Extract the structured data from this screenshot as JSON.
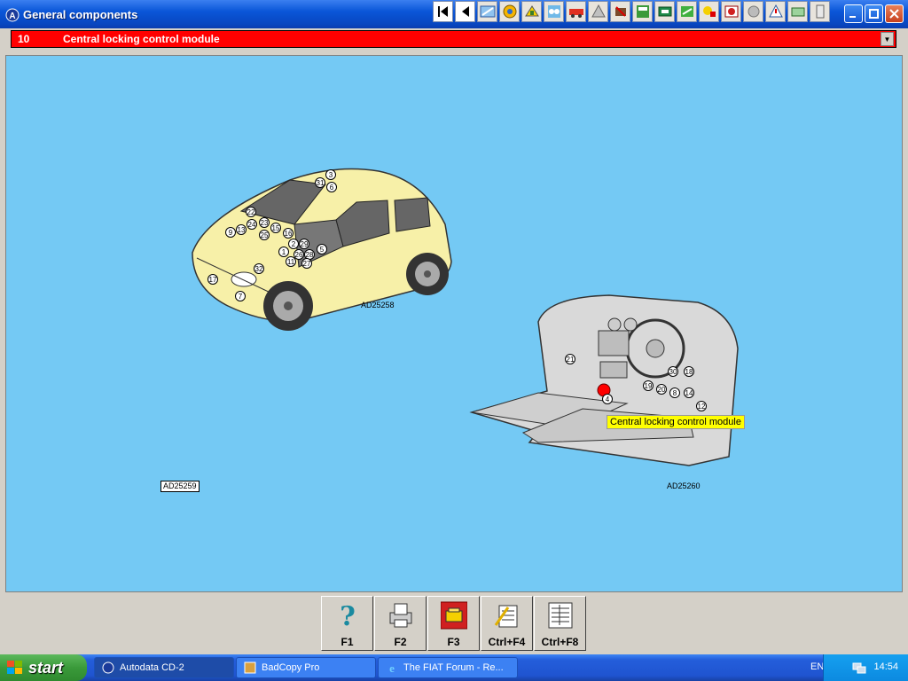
{
  "window": {
    "title": "General components",
    "toolbar_icons": [
      "first-page-icon",
      "previous-page-icon",
      "tool-1-icon",
      "tool-2-icon",
      "tool-3-icon",
      "tool-4-icon",
      "tool-5-icon",
      "tool-6-icon",
      "tool-7-icon",
      "tool-8-icon",
      "tool-9-icon",
      "tool-10-icon",
      "tool-11-icon",
      "tool-12-icon",
      "tool-13-icon",
      "tool-14-icon",
      "tool-15-icon"
    ]
  },
  "selector": {
    "number": "10",
    "value": "Central locking control module"
  },
  "diagram": {
    "car_ref": "AD25258",
    "dash_ref": "AD25260",
    "box_ref": "AD25259",
    "tooltip": "Central locking control module",
    "car_callouts": [
      "3",
      "31",
      "6",
      "22",
      "23",
      "24",
      "13",
      "9",
      "15",
      "16",
      "25",
      "2",
      "29",
      "1",
      "26",
      "28",
      "5",
      "11",
      "27",
      "32",
      "17",
      "7"
    ],
    "dash_callouts": [
      "21",
      "30",
      "18",
      "19",
      "20",
      "8",
      "14",
      "4",
      "12"
    ]
  },
  "function_keys": [
    {
      "label": "F1",
      "icon": "help-icon"
    },
    {
      "label": "F2",
      "icon": "print-icon"
    },
    {
      "label": "F3",
      "icon": "module-icon"
    },
    {
      "label": "Ctrl+F4",
      "icon": "edit-notes-icon"
    },
    {
      "label": "Ctrl+F8",
      "icon": "list-icon"
    }
  ],
  "taskbar": {
    "start": "start",
    "tasks": [
      "Autodata CD-2",
      "BadCopy Pro",
      "The FIAT Forum - Re..."
    ],
    "language": "EN",
    "time": "14:54"
  },
  "colors": {
    "canvas": "#74c9f4",
    "selector": "#ff0000",
    "car_body": "#f7f0a8",
    "tooltip": "#ffff00",
    "highlight_dot": "#ff0000"
  }
}
